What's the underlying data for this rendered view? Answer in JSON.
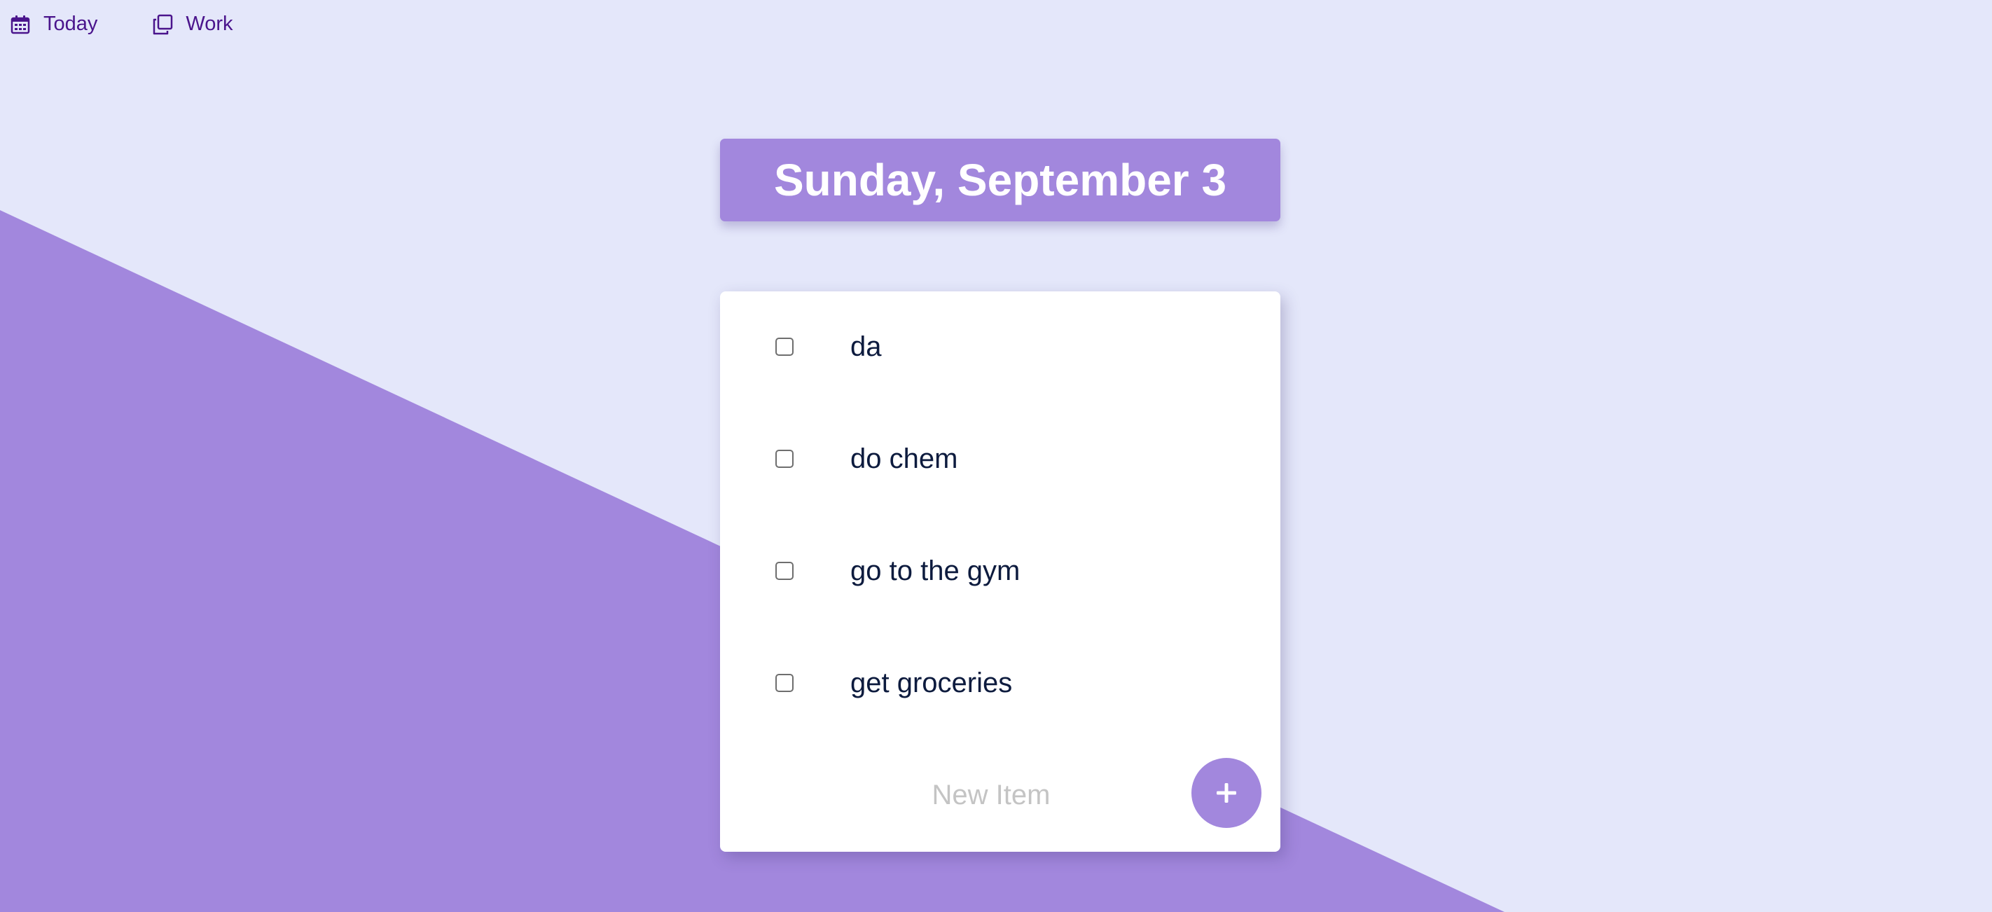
{
  "colors": {
    "background": "#E4E7FA",
    "accent": "#A287DD",
    "nav_text": "#4A148C",
    "item_text": "#0D1B3E",
    "placeholder": "#C4C4C4"
  },
  "nav": {
    "items": [
      {
        "label": "Today",
        "icon": "calendar-icon"
      },
      {
        "label": "Work",
        "icon": "copy-icon"
      }
    ]
  },
  "header": {
    "title": "Sunday, September 3"
  },
  "todo": {
    "items": [
      {
        "text": "da",
        "checked": false
      },
      {
        "text": "do chem",
        "checked": false
      },
      {
        "text": "go to the gym",
        "checked": false
      },
      {
        "text": "get groceries",
        "checked": false
      }
    ],
    "new_item": {
      "placeholder": "New Item",
      "value": ""
    },
    "add_button": {
      "label": "+",
      "icon": "plus-icon"
    }
  }
}
